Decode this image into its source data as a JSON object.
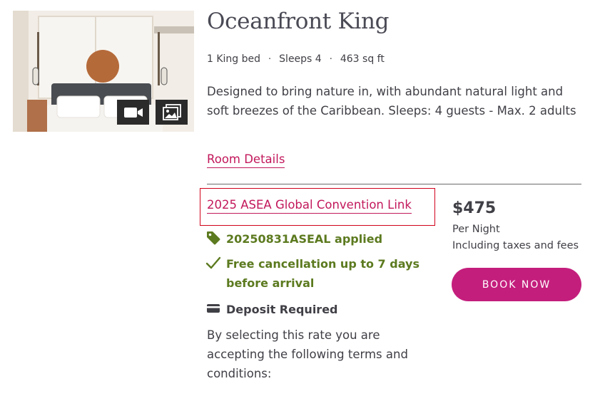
{
  "room": {
    "title": "Oceanfront King",
    "meta": [
      "1 King bed",
      "Sleeps 4",
      "463 sq ft"
    ],
    "description": "Designed to bring nature in, with abundant natural light and soft breezes of the Caribbean. Sleeps: 4 guests - Max. 2 adults",
    "details_link": "Room Details"
  },
  "media": {
    "video_icon": "video-camera-icon",
    "gallery_icon": "photo-gallery-icon"
  },
  "rate": {
    "name": "2025 ASEA Global Convention Link",
    "promo_applied": "20250831ASEAL applied",
    "cancellation": "Free cancellation up to 7 days before arrival",
    "deposit": "Deposit Required",
    "terms": "By selecting this rate you are accepting the following terms and conditions:",
    "icons": {
      "promo": "tag-icon",
      "cancellation": "checkmark-icon",
      "deposit": "credit-card-icon"
    }
  },
  "price": {
    "amount": "$475",
    "per_night": "Per Night",
    "taxes_note": "Including taxes and fees",
    "book_label": "BOOK NOW"
  },
  "colors": {
    "link": "#c2185b",
    "highlight_box": "#d0021b",
    "perk_green": "#5c7a1f",
    "book_button": "#c41e7d",
    "text": "#3f3f46"
  }
}
